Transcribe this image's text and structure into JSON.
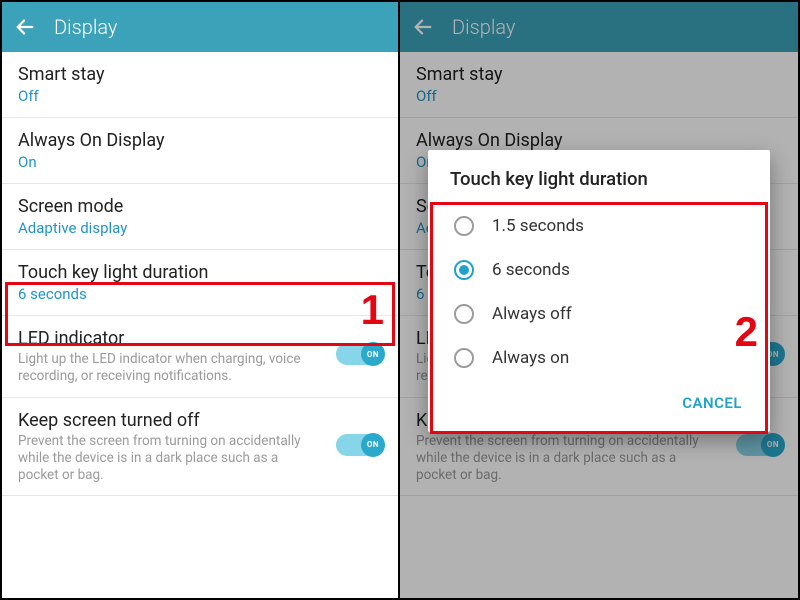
{
  "header": {
    "title": "Display"
  },
  "settings": {
    "smart_stay": {
      "title": "Smart stay",
      "value": "Off"
    },
    "aod": {
      "title": "Always On Display",
      "value": "On"
    },
    "screen_mode": {
      "title": "Screen mode",
      "value": "Adaptive display"
    },
    "touch_key": {
      "title": "Touch key light duration",
      "value": "6 seconds"
    },
    "led": {
      "title": "LED indicator",
      "desc": "Light up the LED indicator when charging, voice recording, or receiving notifications.",
      "toggle_label": "ON"
    },
    "keep_off": {
      "title": "Keep screen turned off",
      "desc": "Prevent the screen from turning on accidentally while the device is in a dark place such as a pocket or bag.",
      "toggle_label": "ON"
    }
  },
  "dialog": {
    "title": "Touch key light duration",
    "options": [
      "1.5 seconds",
      "6 seconds",
      "Always off",
      "Always on"
    ],
    "selected_index": 1,
    "cancel": "CANCEL"
  },
  "markers": {
    "one": "1",
    "two": "2"
  }
}
